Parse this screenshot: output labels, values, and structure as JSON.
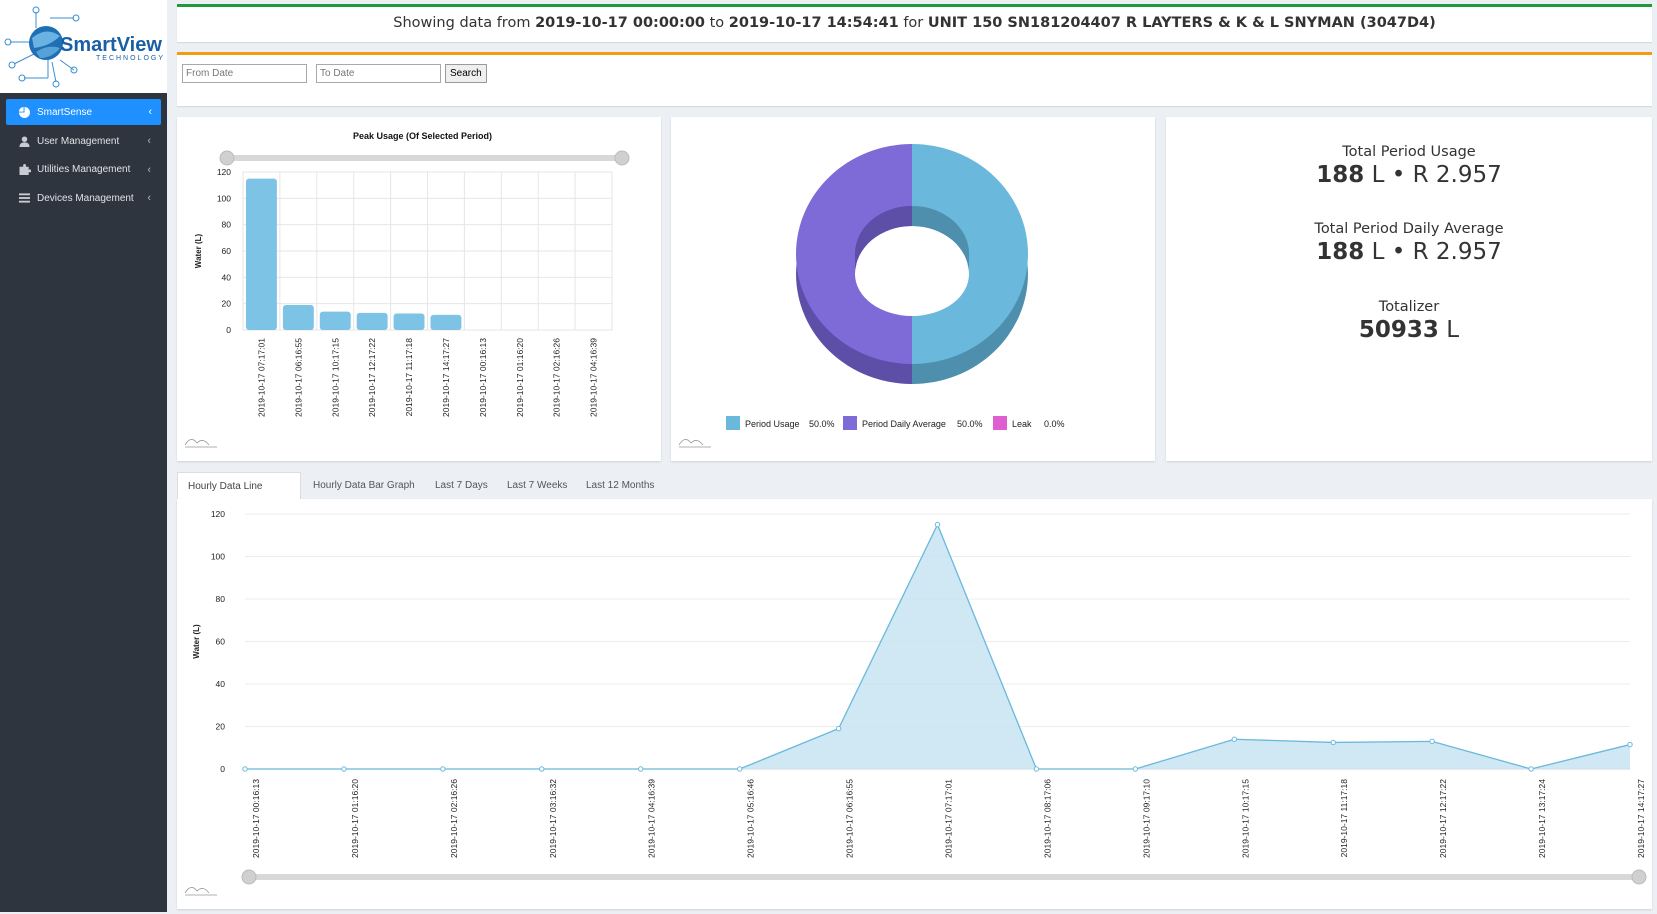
{
  "logo": {
    "brand": "SmartView",
    "tagline": "TECHNOLOGY"
  },
  "sidebar": {
    "items": [
      {
        "label": "SmartSense",
        "icon": "pie-chart-icon"
      },
      {
        "label": "User Management",
        "icon": "user-icon"
      },
      {
        "label": "Utilities Management",
        "icon": "puzzle-icon"
      },
      {
        "label": "Devices Management",
        "icon": "menu-icon"
      }
    ]
  },
  "header": {
    "prefix": "Showing data from ",
    "from": "2019-10-17 00:00:00",
    "mid1": " to ",
    "to": "2019-10-17 14:54:41",
    "mid2": " for ",
    "unit": "UNIT 150 SN181204407 R LAYTERS & K & L SNYMAN (3047D4)"
  },
  "filter": {
    "from_placeholder": "From Date",
    "to_placeholder": "To Date",
    "search_label": "Search"
  },
  "stats": {
    "total_label": "Total Period Usage",
    "total_amount": "188",
    "total_rest": " L • R 2.957",
    "avg_label": "Total Period Daily Average",
    "avg_amount": "188",
    "avg_rest": " L • R 2.957",
    "totalizer_label": "Totalizer",
    "totalizer_amount": "50933",
    "totalizer_rest": " L"
  },
  "tabs": [
    "Hourly Data Line Graph",
    "Hourly Data Bar Graph",
    "Last 7 Days",
    "Last 7 Weeks",
    "Last 12 Months"
  ],
  "colors": {
    "accent_blue": "#1e90ff",
    "header_green": "#1f9a3a",
    "filter_orange": "#f39c12",
    "bar_blue": "#7dc3e6",
    "pie_blue": "#6ab8dc",
    "pie_purple": "#7e6bd8",
    "leak_pink": "#e05fd0"
  },
  "chart_data": [
    {
      "type": "bar",
      "title": "Peak Usage (Of Selected Period)",
      "ylabel": "Water (L)",
      "xlabel": "",
      "ylim": [
        0,
        120
      ],
      "yticks": [
        0,
        20,
        40,
        60,
        80,
        100,
        120
      ],
      "categories": [
        "2019-10-17 07:17:01",
        "2019-10-17 06:16:55",
        "2019-10-17 10:17:15",
        "2019-10-17 12:17:22",
        "2019-10-17 11:17:18",
        "2019-10-17 14:17:27",
        "2019-10-17 00:16:13",
        "2019-10-17 01:16:20",
        "2019-10-17 02:16:26",
        "2019-10-17 04:16:39"
      ],
      "values": [
        115,
        19,
        14,
        13,
        12.5,
        11.5,
        0,
        0,
        0,
        0
      ],
      "grid": true
    },
    {
      "type": "pie",
      "labels": [
        "Period Usage",
        "Period Daily Average",
        "Leak"
      ],
      "values": [
        50.0,
        50.0,
        0.0
      ],
      "percent_labels": [
        "50.0%",
        "50.0%",
        "0.0%"
      ],
      "colors": [
        "#6ab8dc",
        "#7e6bd8",
        "#e05fd0"
      ],
      "legend": "bottom"
    },
    {
      "type": "area",
      "ylabel": "Water (L)",
      "xlabel": "",
      "ylim": [
        0,
        120
      ],
      "yticks": [
        0,
        20,
        40,
        60,
        80,
        100,
        120
      ],
      "x": [
        "2019-10-17 00:16:13",
        "2019-10-17 01:16:20",
        "2019-10-17 02:16:26",
        "2019-10-17 03:16:32",
        "2019-10-17 04:16:39",
        "2019-10-17 05:16:46",
        "2019-10-17 06:16:55",
        "2019-10-17 07:17:01",
        "2019-10-17 08:17:06",
        "2019-10-17 09:17:10",
        "2019-10-17 10:17:15",
        "2019-10-17 11:17:18",
        "2019-10-17 12:17:22",
        "2019-10-17 13:17:24",
        "2019-10-17 14:17:27"
      ],
      "values": [
        0,
        0,
        0,
        0,
        0,
        0,
        19,
        115,
        0,
        0,
        14,
        12.5,
        13,
        0,
        11.5
      ],
      "grid": true
    }
  ]
}
